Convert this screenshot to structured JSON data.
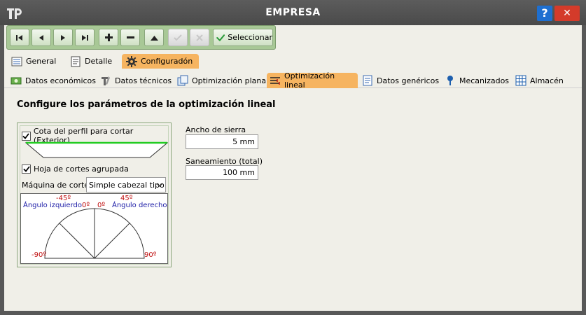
{
  "window": {
    "title": "EMPRESA",
    "help": "?",
    "close": "✕"
  },
  "toolbar": {
    "buttons": [
      {
        "name": "first-record-button",
        "icon": "first-icon"
      },
      {
        "name": "prev-record-button",
        "icon": "prev-icon"
      },
      {
        "name": "next-record-button",
        "icon": "next-icon"
      },
      {
        "name": "last-record-button",
        "icon": "last-icon"
      },
      {
        "name": "add-button",
        "icon": "plus-icon"
      },
      {
        "name": "remove-button",
        "icon": "minus-icon"
      },
      {
        "name": "up-button",
        "icon": "up-icon"
      },
      {
        "name": "confirm-button",
        "icon": "check-icon",
        "disabled": true
      },
      {
        "name": "cancel-button",
        "icon": "x-icon",
        "disabled": true
      }
    ],
    "select_label": "Seleccionar"
  },
  "main_tabs": [
    {
      "label": "General",
      "icon": "list-icon"
    },
    {
      "label": "Detalle",
      "icon": "document-icon"
    },
    {
      "label": "Configuradón",
      "icon": "gear-icon",
      "active": true
    }
  ],
  "sub_tabs": [
    {
      "label": "Datos económicos",
      "icon": "money-icon"
    },
    {
      "label": "Datos técnicos",
      "icon": "tools-icon"
    },
    {
      "label": "Optimización plana",
      "icon": "sheets-icon"
    },
    {
      "label": "Optimización lineal",
      "icon": "linear-icon",
      "active": true
    },
    {
      "label": "Datos genéricos",
      "icon": "document-icon"
    },
    {
      "label": "Mecanizados",
      "icon": "pin-icon"
    },
    {
      "label": "Almacén",
      "icon": "grid-icon"
    }
  ],
  "panel": {
    "heading": "Configure los parámetros de la optimización lineal",
    "cota_label": "Cota del perfil para cortar (Exterior)",
    "cota_checked": true,
    "hoja_label": "Hoja de cortes agrupada",
    "hoja_checked": true,
    "machine_label": "Máquina de corte",
    "machine_value": "Simple cabezal tipo",
    "angles": {
      "left_title": "Ángulo izquierdo",
      "right_title": "Ángulo derecho",
      "minus45": "-45º",
      "plus45": "45º",
      "zero_left": "0º",
      "zero_right": "0º",
      "minus90": "-90º",
      "plus90": "90º"
    },
    "ancho_label": "Ancho de sierra",
    "ancho_value": "5 mm",
    "saneamiento_label": "Saneamiento (total)",
    "saneamiento_value": "100 mm"
  },
  "colors": {
    "accent_tab": "#f6b460",
    "toolbar_green": "#a8c896",
    "profile_green": "#22cc22",
    "angle_red": "#c01010",
    "angle_blue": "#1a1aa6"
  }
}
